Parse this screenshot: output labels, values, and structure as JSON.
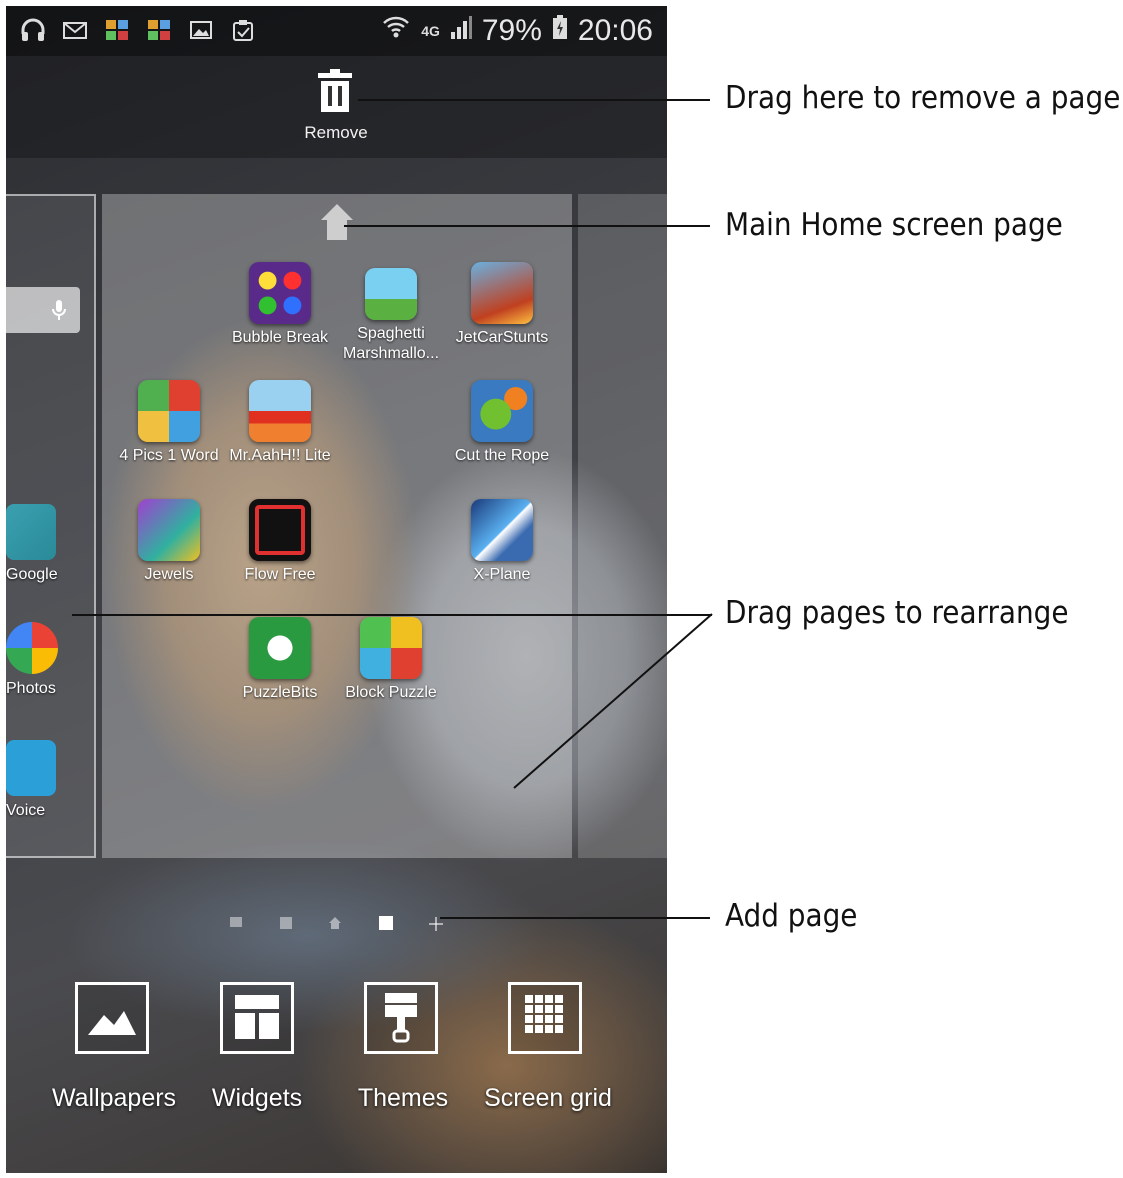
{
  "status_bar": {
    "network": "4G",
    "battery": "79%",
    "time": "20:06",
    "left_icons": [
      "headphones-icon",
      "gmail-icon",
      "app-notification-icon",
      "app-notification-icon",
      "gallery-icon",
      "clipboard-icon"
    ]
  },
  "remove_zone": {
    "label": "Remove"
  },
  "left_page_apps": [
    {
      "label": "Google"
    },
    {
      "label": "Photos"
    },
    {
      "label": "Voice"
    }
  ],
  "main_page_apps": [
    {
      "label": "Bubble Break"
    },
    {
      "label": "Spaghetti Marshmallo..."
    },
    {
      "label": "JetCarStunts"
    },
    {
      "label": "4 Pics 1 Word"
    },
    {
      "label": "Mr.AahH!! Lite"
    },
    {
      "label": "Cut the Rope"
    },
    {
      "label": "Jewels"
    },
    {
      "label": "Flow Free"
    },
    {
      "label": "X-Plane"
    },
    {
      "label": "PuzzleBits"
    },
    {
      "label": "Block Puzzle"
    }
  ],
  "page_indicator": {
    "pages": 4,
    "current_page": 4,
    "home_page": 3
  },
  "bottom_bar": {
    "wallpapers": "Wallpapers",
    "widgets": "Widgets",
    "themes": "Themes",
    "screen_grid": "Screen grid"
  },
  "callouts": {
    "remove": "Drag here to remove a page",
    "main_home": "Main Home screen page",
    "rearrange": "Drag pages to rearrange",
    "add_page": "Add page"
  }
}
